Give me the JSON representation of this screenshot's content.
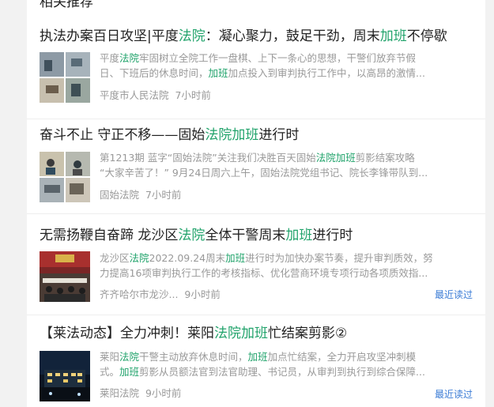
{
  "truncated_heading": "相关推荐",
  "items": [
    {
      "title": [
        "执法办案百日攻坚|平度",
        "法院",
        "：凝心聚力，鼓足干劲，周末",
        "加班",
        "不停歇"
      ],
      "summary_line1": [
        "平度",
        "法院",
        "牢固树立全院工作一盘棋、上下一条心的思想，干警们放弃节假"
      ],
      "summary_line2": [
        "日、下班后的休息时间，",
        "加班",
        "加点投入到审判执行工作中，以高昂的激情..."
      ],
      "source": "平度市人民法院",
      "time": "7小时前",
      "recent": ""
    },
    {
      "title": [
        "奋斗不止 守正不移——固始",
        "法院",
        "加班",
        "进行时"
      ],
      "summary_line1": [
        "第1213期 蓝字“固始法院”关注我们决胜百天固始",
        "法院加班",
        "剪影结案攻略"
      ],
      "summary_line2": [
        "“大家辛苦了！” 9月24日周六上午，固始法院党组书记、院长李锋带队到..."
      ],
      "source": "固始法院",
      "time": "7小时前",
      "recent": ""
    },
    {
      "title": [
        "无需扬鞭自奋蹄 龙沙区",
        "法院",
        "全体干警周末",
        "加班",
        "进行时"
      ],
      "summary_line1": [
        "龙沙区",
        "法院",
        "2022.09.24周末",
        "加班",
        "进行时为加快办案节奏，提升审判质效，努"
      ],
      "summary_line2": [
        "力提高16项审判执行工作的考核指标、优化营商环境专项行动各项质效指..."
      ],
      "source": "齐齐哈尔市龙沙...",
      "time": "9小时前",
      "recent": "最近读过"
    },
    {
      "title": [
        "【莱法动态】全力冲刺！莱阳",
        "法院加班",
        "忙结案剪影②"
      ],
      "summary_line1": [
        "莱阳",
        "法院",
        "干警主动放弃休息时间，",
        "加班",
        "加点忙结案，全力开启攻坚冲刺模"
      ],
      "summary_line2": [
        "式。",
        "加班",
        "剪影从员额法官到法官助理、书记员，从审判到执行到综合保障..."
      ],
      "source": "莱阳法院",
      "time": "9小时前",
      "recent": "最近读过"
    }
  ],
  "colors": {
    "highlight": "#21a36b",
    "link": "#3a7bd5",
    "muted": "#999999"
  }
}
